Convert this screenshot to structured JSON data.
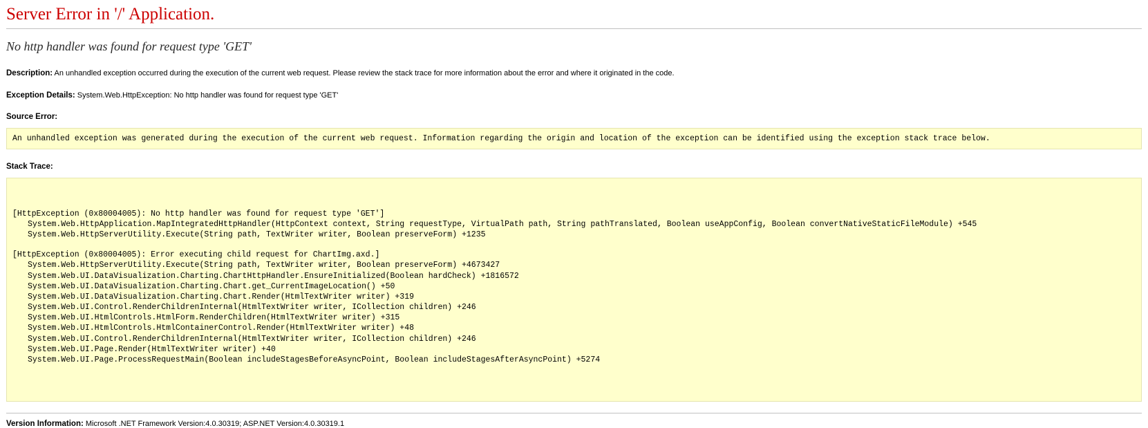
{
  "header": {
    "server_error_heading": "Server Error in '/' Application.",
    "error_title": "No http handler was found for request type 'GET'"
  },
  "description": {
    "label": "Description:",
    "text": "An unhandled exception occurred during the execution of the current web request. Please review the stack trace for more information about the error and where it originated in the code."
  },
  "exception_details": {
    "label": "Exception Details:",
    "text": "System.Web.HttpException: No http handler was found for request type 'GET'"
  },
  "source_error": {
    "label": "Source Error:",
    "code": "An unhandled exception was generated during the execution of the current web request. Information regarding the origin and location of the exception can be identified using the exception stack trace below."
  },
  "stack_trace": {
    "label": "Stack Trace:",
    "lines": [
      {
        "text": "[HttpException (0x80004005): No http handler was found for request type 'GET']",
        "indent": false
      },
      {
        "text": "System.Web.HttpApplication.MapIntegratedHttpHandler(HttpContext context, String requestType, VirtualPath path, String pathTranslated, Boolean useAppConfig, Boolean convertNativeStaticFileModule) +545",
        "indent": true
      },
      {
        "text": "System.Web.HttpServerUtility.Execute(String path, TextWriter writer, Boolean preserveForm) +1235",
        "indent": true
      },
      {
        "text": "",
        "indent": false
      },
      {
        "text": "[HttpException (0x80004005): Error executing child request for ChartImg.axd.]",
        "indent": false
      },
      {
        "text": "System.Web.HttpServerUtility.Execute(String path, TextWriter writer, Boolean preserveForm) +4673427",
        "indent": true
      },
      {
        "text": "System.Web.UI.DataVisualization.Charting.ChartHttpHandler.EnsureInitialized(Boolean hardCheck) +1816572",
        "indent": true
      },
      {
        "text": "System.Web.UI.DataVisualization.Charting.Chart.get_CurrentImageLocation() +50",
        "indent": true
      },
      {
        "text": "System.Web.UI.DataVisualization.Charting.Chart.Render(HtmlTextWriter writer) +319",
        "indent": true
      },
      {
        "text": "System.Web.UI.Control.RenderChildrenInternal(HtmlTextWriter writer, ICollection children) +246",
        "indent": true
      },
      {
        "text": "System.Web.UI.HtmlControls.HtmlForm.RenderChildren(HtmlTextWriter writer) +315",
        "indent": true
      },
      {
        "text": "System.Web.UI.HtmlControls.HtmlContainerControl.Render(HtmlTextWriter writer) +48",
        "indent": true
      },
      {
        "text": "System.Web.UI.Control.RenderChildrenInternal(HtmlTextWriter writer, ICollection children) +246",
        "indent": true
      },
      {
        "text": "System.Web.UI.Page.Render(HtmlTextWriter writer) +40",
        "indent": true
      },
      {
        "text": "System.Web.UI.Page.ProcessRequestMain(Boolean includeStagesBeforeAsyncPoint, Boolean includeStagesAfterAsyncPoint) +5274",
        "indent": true
      }
    ]
  },
  "version_information": {
    "label": "Version Information:",
    "text": "Microsoft .NET Framework Version:4.0.30319; ASP.NET Version:4.0.30319.1"
  },
  "colors": {
    "error_heading": "#cc0000",
    "code_background": "#ffffcc",
    "code_border": "#e5e5b0",
    "rule": "#c0c0c0"
  }
}
